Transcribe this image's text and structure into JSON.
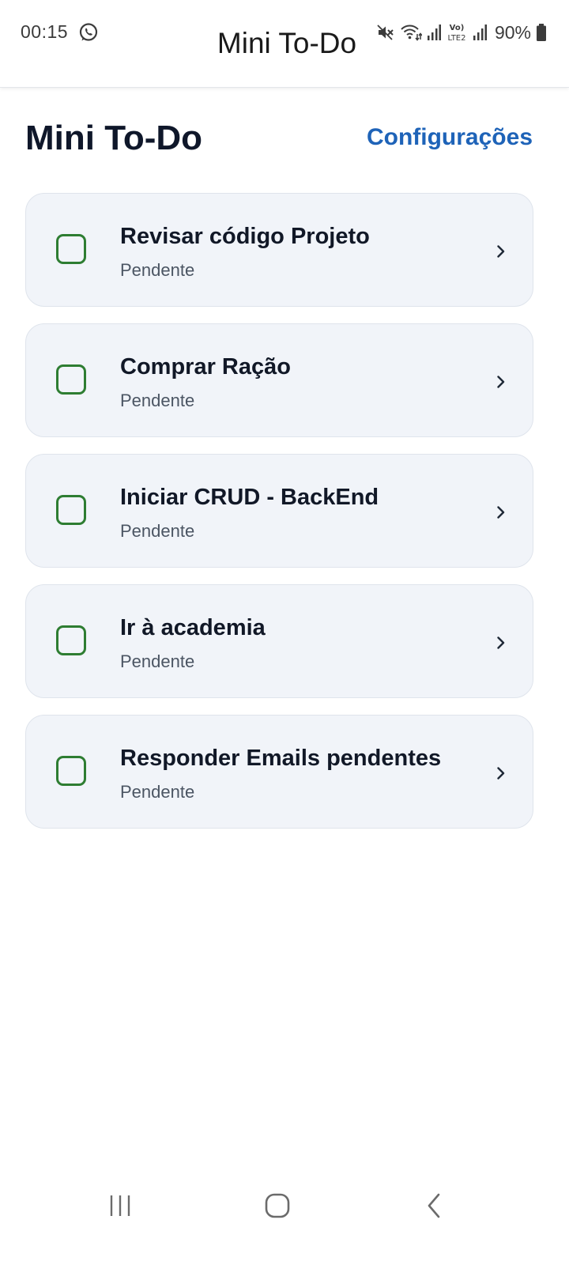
{
  "status_bar": {
    "time": "00:15",
    "battery": "90%",
    "icons": [
      "whatsapp-icon",
      "mute-icon",
      "wifi-icon",
      "signal-icon",
      "volte-icon",
      "battery-icon"
    ],
    "volte_label_top": "Vo)",
    "volte_label_bottom": "LTE2"
  },
  "app_bar": {
    "title": "Mini To-Do"
  },
  "header": {
    "title": "Mini To-Do",
    "settings_label": "Configurações"
  },
  "colors": {
    "accent": "#1e63b8",
    "checkbox": "#2e7d32",
    "card_bg": "#f1f4f9",
    "card_border": "#dfe4ec"
  },
  "tasks": [
    {
      "title": "Revisar código Projeto",
      "status": "Pendente",
      "done": false
    },
    {
      "title": "Comprar Ração",
      "status": "Pendente",
      "done": false
    },
    {
      "title": "Iniciar CRUD - BackEnd",
      "status": "Pendente",
      "done": false
    },
    {
      "title": "Ir à academia",
      "status": "Pendente",
      "done": false
    },
    {
      "title": "Responder Emails pendentes",
      "status": "Pendente",
      "done": false
    }
  ],
  "nav_bar": {
    "icons": [
      "recent-apps-icon",
      "home-icon",
      "back-icon"
    ]
  }
}
